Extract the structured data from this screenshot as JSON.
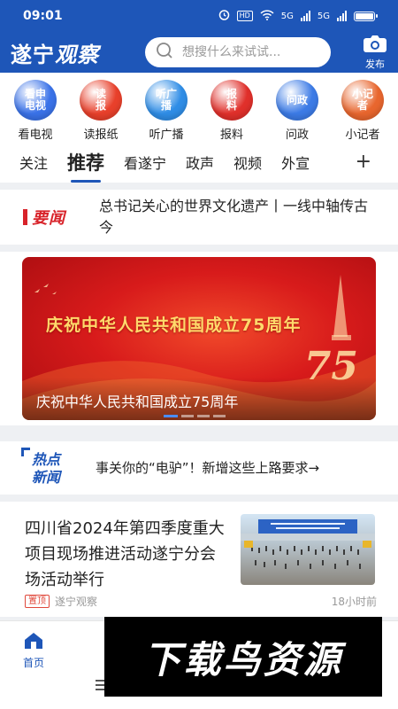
{
  "status_bar": {
    "time": "09:01",
    "network_1": "5G",
    "network_2": "5G",
    "hd": "HD"
  },
  "header": {
    "logo_part1": "遂宁",
    "logo_part2": "观察",
    "search_placeholder": "想搜什么来试试...",
    "publish_label": "发布"
  },
  "shortcuts": [
    {
      "icon_text": "看申\n电视",
      "label": "看电视",
      "color": "#3a72e8"
    },
    {
      "icon_text": "读\n报",
      "label": "读报纸",
      "color": "#e8402b"
    },
    {
      "icon_text": "听广\n播",
      "label": "听广播",
      "color": "#2f8de6"
    },
    {
      "icon_text": "报\n料",
      "label": "报料",
      "color": "#e0302b"
    },
    {
      "icon_text": "问政",
      "label": "问政",
      "color": "#3c7be6"
    },
    {
      "icon_text": "小记\n者",
      "label": "小记者",
      "color": "#e8662e"
    }
  ],
  "tabs": [
    {
      "label": "关注",
      "active": false
    },
    {
      "label": "推荐",
      "active": true
    },
    {
      "label": "看遂宁",
      "active": false
    },
    {
      "label": "政声",
      "active": false
    },
    {
      "label": "视频",
      "active": false
    },
    {
      "label": "外宣",
      "active": false
    }
  ],
  "tabs_more": "+",
  "headline": {
    "tag": "要闻",
    "text": "总书记关心的世界文化遗产丨一线中轴传古今"
  },
  "banner": {
    "title": "庆祝中华人民共和国成立75周年",
    "big_number": "75",
    "caption": "庆祝中华人民共和国成立75周年"
  },
  "hot": {
    "tag_line1": "热点",
    "tag_line2": "新闻",
    "text": "事关你的“电驴”！新增这些上路要求→"
  },
  "news": {
    "title": "四川省2024年第四季度重大项目现场推进活动遂宁分会场活动举行",
    "pin_label": "置顶",
    "source": "遂宁观察",
    "time": "18小时前"
  },
  "bottom_nav": {
    "home_label": "首页"
  },
  "watermark": {
    "text": "下载鸟资源"
  },
  "colors": {
    "brand": "#1e56b8",
    "red": "#d8232a"
  }
}
